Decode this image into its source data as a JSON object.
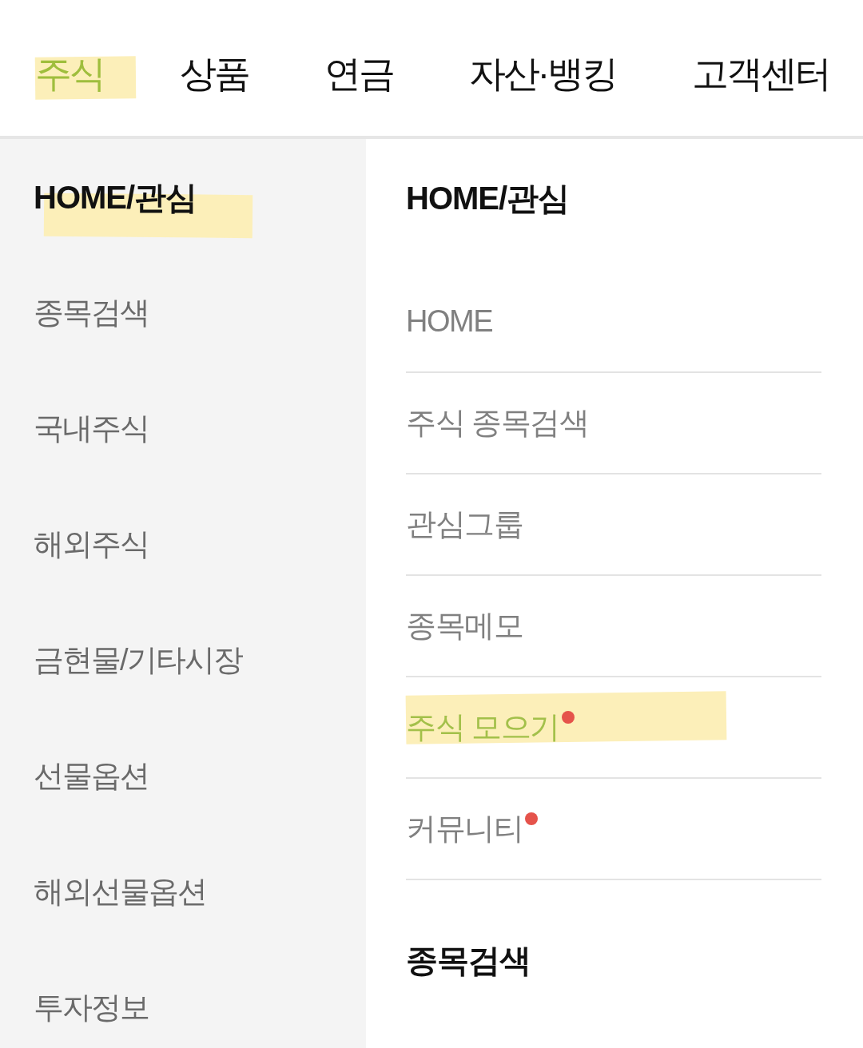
{
  "tabs": [
    {
      "label": "주식",
      "selected": true,
      "highlighted": true
    },
    {
      "label": "상품",
      "selected": false,
      "highlighted": false
    },
    {
      "label": "연금",
      "selected": false,
      "highlighted": false
    },
    {
      "label": "자산·뱅킹",
      "selected": false,
      "highlighted": false
    },
    {
      "label": "고객센터",
      "selected": false,
      "highlighted": false
    }
  ],
  "sidebar": {
    "items": [
      {
        "label": "HOME/관심",
        "selected": true,
        "highlighted": true
      },
      {
        "label": "종목검색",
        "selected": false,
        "highlighted": false
      },
      {
        "label": "국내주식",
        "selected": false,
        "highlighted": false
      },
      {
        "label": "해외주식",
        "selected": false,
        "highlighted": false
      },
      {
        "label": "금현물/기타시장",
        "selected": false,
        "highlighted": false
      },
      {
        "label": "선물옵션",
        "selected": false,
        "highlighted": false
      },
      {
        "label": "해외선물옵션",
        "selected": false,
        "highlighted": false
      },
      {
        "label": "투자정보",
        "selected": false,
        "highlighted": false
      }
    ]
  },
  "content": {
    "sections": [
      {
        "title": "HOME/관심",
        "items": [
          {
            "label": "HOME",
            "selected": false,
            "new": false,
            "highlighted": false
          },
          {
            "label": "주식 종목검색",
            "selected": false,
            "new": false,
            "highlighted": false
          },
          {
            "label": "관심그룹",
            "selected": false,
            "new": false,
            "highlighted": false
          },
          {
            "label": "종목메모",
            "selected": false,
            "new": false,
            "highlighted": false
          },
          {
            "label": "주식 모으기",
            "selected": true,
            "new": true,
            "highlighted": true
          },
          {
            "label": "커뮤니티",
            "selected": false,
            "new": true,
            "highlighted": false
          }
        ]
      },
      {
        "title": "종목검색"
      }
    ]
  }
}
